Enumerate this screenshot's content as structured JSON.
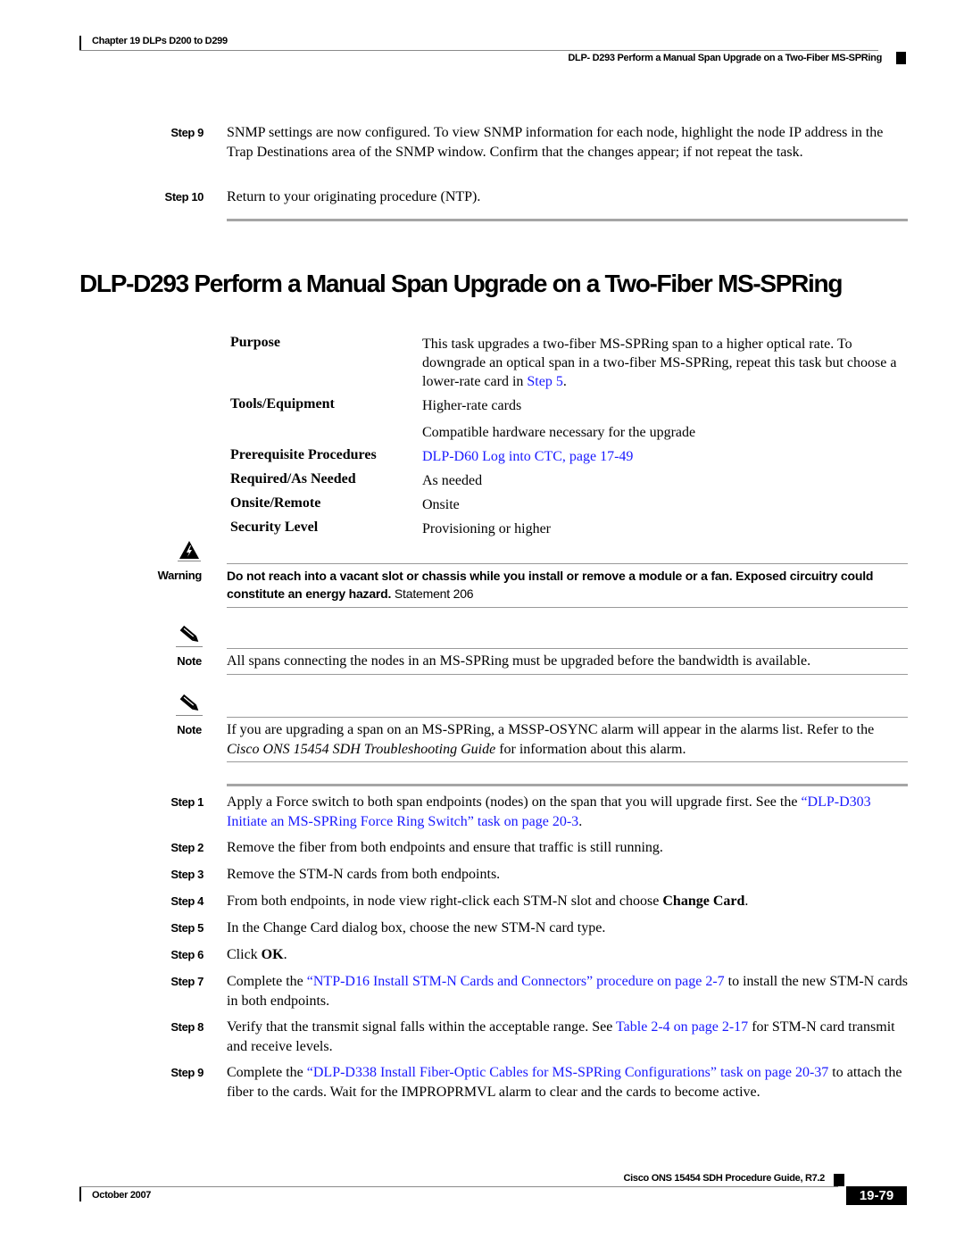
{
  "header": {
    "chapter": "Chapter 19 DLPs D200 to D299",
    "section": "DLP- D293 Perform a Manual Span Upgrade on a Two-Fiber MS-SPRing"
  },
  "prior_steps": [
    {
      "label": "Step 9",
      "text": "SNMP settings are now configured. To view SNMP information for each node, highlight the node IP address in the Trap Destinations area of the SNMP window. Confirm that the changes appear; if not repeat the task."
    },
    {
      "label": "Step 10",
      "text": "Return to your originating procedure (NTP)."
    }
  ],
  "title": "DLP-D293 Perform a Manual Span Upgrade on a Two-Fiber MS-SPRing",
  "task_table": {
    "purpose_label": "Purpose",
    "purpose_text": "This task upgrades a two-fiber MS-SPRing span to a higher optical rate. To downgrade an optical span in a two-fiber MS-SPRing, repeat this task but choose a lower-rate card in ",
    "purpose_link": "Step 5",
    "purpose_end": ".",
    "tools_label": "Tools/Equipment",
    "tools_1": "Higher-rate cards",
    "tools_2": "Compatible hardware necessary for the upgrade",
    "prereq_label": "Prerequisite Procedures",
    "prereq_link": "DLP-D60 Log into CTC, page 17-49",
    "required_label": "Required/As Needed",
    "required_value": "As needed",
    "onsite_label": "Onsite/Remote",
    "onsite_value": "Onsite",
    "security_label": "Security Level",
    "security_value": "Provisioning or higher"
  },
  "warning": {
    "label": "Warning",
    "bold_text": "Do not reach into a vacant slot or chassis while you install or remove a module or a fan. Exposed circuitry could constitute an energy hazard.",
    "statement": " Statement 206"
  },
  "notes": [
    {
      "label": "Note",
      "text": "All spans connecting the nodes in an MS-SPRing must be upgraded before the bandwidth is available."
    },
    {
      "label": "Note",
      "text_before": "If you are upgrading a span on an MS-SPRing, a MSSP-OSYNC alarm will appear in the alarms list. Refer to the ",
      "italic": "Cisco ONS 15454 SDH Troubleshooting Guide",
      "text_after": " for information about this alarm."
    }
  ],
  "steps": [
    {
      "label": "Step 1",
      "text": "Apply a Force switch to both span endpoints (nodes) on the span that you will upgrade first. See the ",
      "link": "“DLP-D303 Initiate an MS-SPRing Force Ring Switch” task on page 20-3",
      "text_after": "."
    },
    {
      "label": "Step 2",
      "text": "Remove the fiber from both endpoints and ensure that traffic is still running."
    },
    {
      "label": "Step 3",
      "text": "Remove the STM-N cards from both endpoints."
    },
    {
      "label": "Step 4",
      "text": "From both endpoints, in node view right-click each STM-N slot and choose ",
      "bold": "Change Card",
      "text_after": "."
    },
    {
      "label": "Step 5",
      "text": "In the Change Card dialog box, choose the new STM-N card type."
    },
    {
      "label": "Step 6",
      "text": "Click ",
      "bold": "OK",
      "text_after": "."
    },
    {
      "label": "Step 7",
      "text": "Complete the ",
      "link": "“NTP-D16 Install STM-N Cards and Connectors” procedure on page 2-7",
      "text_after": " to install the new STM-N cards in both endpoints."
    },
    {
      "label": "Step 8",
      "text": "Verify that the transmit signal falls within the acceptable range. See ",
      "link": "Table 2-4 on page 2-17",
      "text_after": " for STM-N card transmit and receive levels."
    },
    {
      "label": "Step 9",
      "text": "Complete the ",
      "link": "“DLP-D338 Install Fiber-Optic Cables for MS-SPRing Configurations” task on page 20-37",
      "text_after": " to attach the fiber to the cards. Wait for the IMPROPRMVL alarm to clear and the cards to become active."
    }
  ],
  "footer": {
    "guide": "Cisco ONS 15454 SDH Procedure Guide, R7.2",
    "date": "October 2007",
    "page": "19-79"
  },
  "colors": {
    "link": "#1a1aff",
    "rule": "#a5a5a5"
  }
}
